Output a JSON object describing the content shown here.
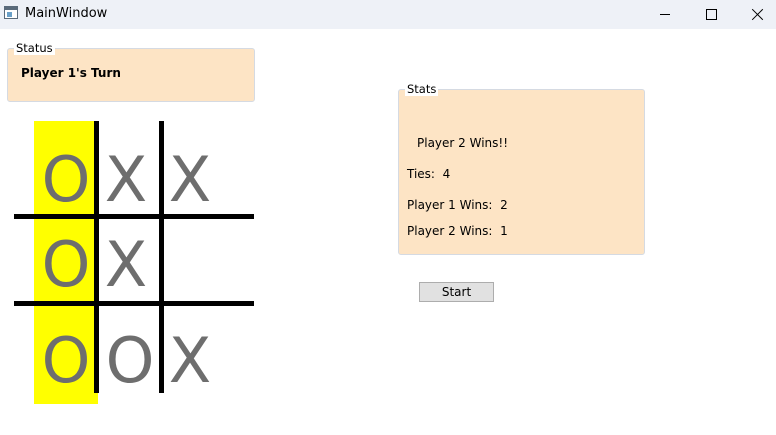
{
  "window": {
    "title": "MainWindow"
  },
  "status": {
    "group_label": "Status",
    "message": "Player 1's Turn"
  },
  "stats": {
    "group_label": "Stats",
    "result": "Player 2 Wins!!",
    "ties": "Ties:  4",
    "p1_wins": "Player 1 Wins:  2",
    "p2_wins": "Player 2 Wins:  1"
  },
  "board": {
    "cells": [
      [
        "O",
        "X",
        "X"
      ],
      [
        "O",
        "X",
        ""
      ],
      [
        "O",
        "O",
        "X"
      ]
    ],
    "winning_column": 0,
    "highlight_color": "#ffff00"
  },
  "controls": {
    "start_label": "Start"
  }
}
